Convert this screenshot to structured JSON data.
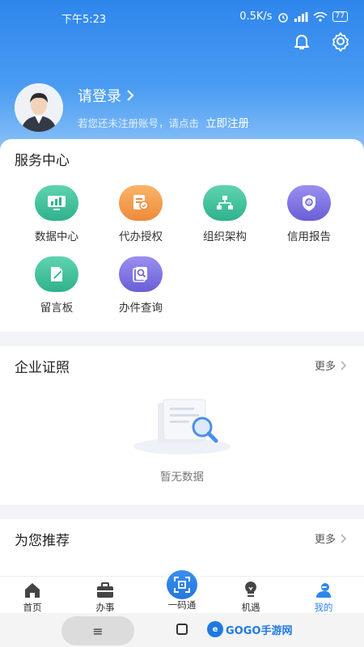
{
  "status_bar": {
    "time": "下午5:23",
    "speed": "0.5K/s",
    "battery": "77"
  },
  "profile": {
    "login_label": "请登录",
    "hint": "若您还未注册账号，请点击",
    "register_link": "立即注册"
  },
  "services": {
    "title": "服务中心",
    "items": [
      {
        "label": "数据中心",
        "icon": "data-center-icon",
        "color": "#3bbf9a"
      },
      {
        "label": "代办授权",
        "icon": "authorization-icon",
        "color": "#f29a4a"
      },
      {
        "label": "组织架构",
        "icon": "org-chart-icon",
        "color": "#3bbf9a"
      },
      {
        "label": "信用报告",
        "icon": "credit-report-icon",
        "color": "#7a6fe0"
      },
      {
        "label": "留言板",
        "icon": "message-board-icon",
        "color": "#3bbf9a"
      },
      {
        "label": "办件查询",
        "icon": "case-query-icon",
        "color": "#7a6fe0"
      }
    ]
  },
  "certificates": {
    "title": "企业证照",
    "more": "更多",
    "empty_text": "暂无数据"
  },
  "recommend": {
    "title": "为您推荐",
    "more": "更多"
  },
  "tabbar": {
    "items": [
      {
        "label": "首页",
        "icon": "home-icon"
      },
      {
        "label": "办事",
        "icon": "briefcase-icon"
      },
      {
        "label": "一码通",
        "icon": "qr-code-icon"
      },
      {
        "label": "机遇",
        "icon": "lightbulb-icon"
      },
      {
        "label": "我的",
        "icon": "profile-icon",
        "active": true
      }
    ]
  },
  "watermark": {
    "text": "GOGO手游网"
  }
}
